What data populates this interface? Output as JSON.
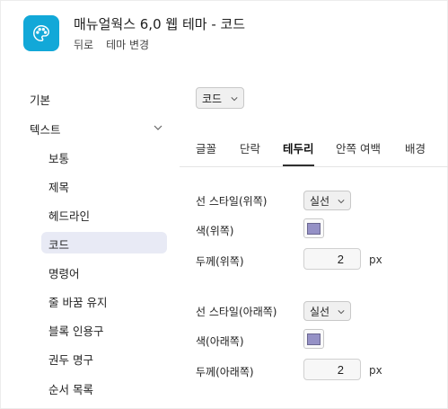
{
  "header": {
    "title": "매뉴얼웍스 6,0 웹 테마 - 코드",
    "back_label": "뒤로",
    "change_theme_label": "테마 변경",
    "icon": "palette-icon",
    "accent_color": "#12a8d8"
  },
  "sidebar": {
    "basic_label": "기본",
    "text_label": "텍스트",
    "text_expanded": true,
    "items": [
      {
        "label": "보통"
      },
      {
        "label": "제목"
      },
      {
        "label": "헤드라인"
      },
      {
        "label": "코드",
        "selected": true
      },
      {
        "label": "명령어"
      },
      {
        "label": "줄 바꿈 유지"
      },
      {
        "label": "블록 인용구"
      },
      {
        "label": "권두 명구"
      },
      {
        "label": "순서 목록"
      }
    ]
  },
  "style_select": {
    "value": "코드"
  },
  "tabs": [
    {
      "label": "글꼴"
    },
    {
      "label": "단락"
    },
    {
      "label": "테두리",
      "active": true
    },
    {
      "label": "안쪽 여백"
    },
    {
      "label": "배경"
    }
  ],
  "border": {
    "top": {
      "style_label": "선 스타일(위쪽)",
      "style_value": "실선",
      "color_label": "색(위쪽)",
      "color_value": "#9591c6",
      "width_label": "두께(위쪽)",
      "width_value": "2",
      "unit": "px"
    },
    "bottom": {
      "style_label": "선 스타일(아래쪽)",
      "style_value": "실선",
      "color_label": "색(아래쪽)",
      "color_value": "#9591c6",
      "width_label": "두께(아래쪽)",
      "width_value": "2",
      "unit": "px"
    }
  }
}
